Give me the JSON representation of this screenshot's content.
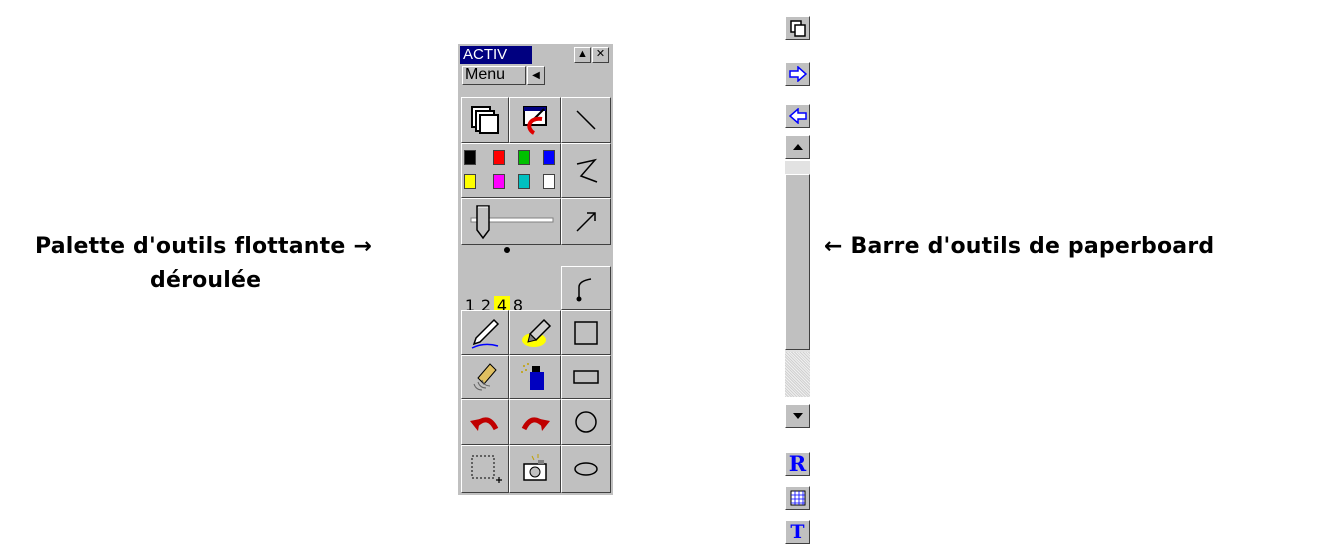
{
  "captions": {
    "palette_line1": "Palette d'outils flottante →",
    "palette_line2": "déroulée",
    "paperboard": "← Barre d'outils de paperboard"
  },
  "palette": {
    "title": "ACTIV",
    "menu_label": "Menu",
    "thickness_options": [
      "1",
      "2",
      "4",
      "8"
    ],
    "selected_thickness": "4",
    "colors": [
      "#000000",
      "#ff0000",
      "#00c000",
      "#0000ff",
      "#ffff00",
      "#ff00ff",
      "#00c0c0",
      "#ffffff"
    ]
  },
  "paperboard_toolbar": {
    "buttons": [
      "pages-icon",
      "next-page-icon",
      "previous-page-icon",
      "scroll-up-icon",
      "scroll-down-icon",
      "reveal-icon",
      "grid-icon",
      "text-icon"
    ],
    "reveal_label": "R",
    "text_label": "T"
  }
}
